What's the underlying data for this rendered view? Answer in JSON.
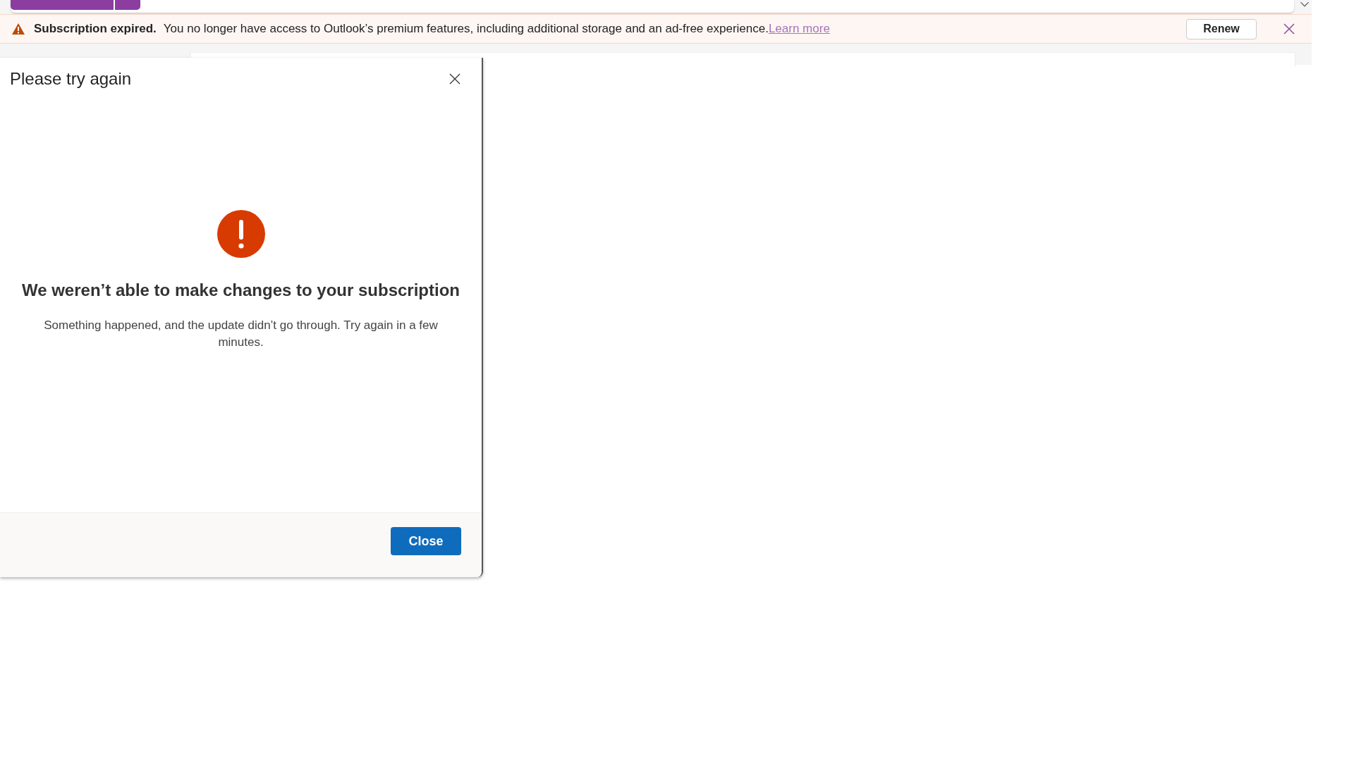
{
  "banner": {
    "title": "Subscription expired.",
    "message": "You no longer have access to Outlook’s premium features, including additional storage and an ad-free experience.",
    "link": "Learn more",
    "button": "Renew"
  },
  "dialog": {
    "title": "Please try again",
    "heading": "We weren’t able to make changes to your subscription",
    "body": "Something happened, and the update didn’t go through. Try again in a few minutes.",
    "button": "Close"
  }
}
